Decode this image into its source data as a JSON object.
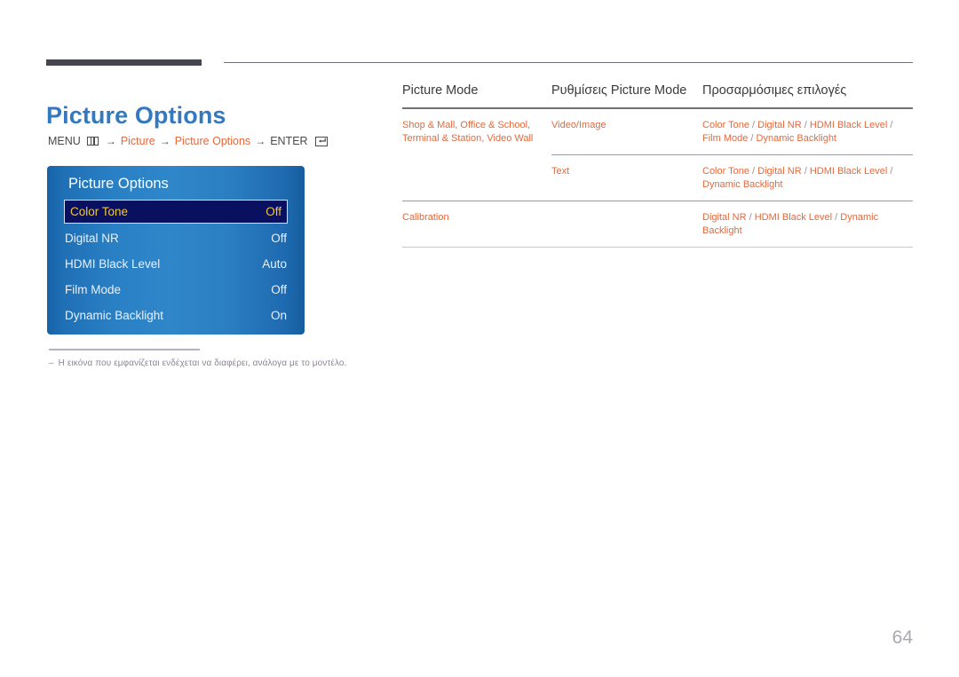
{
  "page": {
    "title": "Picture Options",
    "number": "64"
  },
  "breadcrumb": {
    "menu_label": "MENU",
    "menu_icon": "menu-grid-icon",
    "arrow": "→",
    "items": [
      "Picture",
      "Picture Options"
    ],
    "enter_label": "ENTER",
    "enter_icon": "enter-return-icon"
  },
  "osd": {
    "title": "Picture Options",
    "rows": [
      {
        "label": "Color Tone",
        "value": "Off",
        "selected": true
      },
      {
        "label": "Digital NR",
        "value": "Off",
        "selected": false
      },
      {
        "label": "HDMI Black Level",
        "value": "Auto",
        "selected": false
      },
      {
        "label": "Film Mode",
        "value": "Off",
        "selected": false
      },
      {
        "label": "Dynamic Backlight",
        "value": "On",
        "selected": false
      }
    ]
  },
  "note": {
    "dash": "–",
    "text": "Η εικόνα που εμφανίζεται ενδέχεται να διαφέρει, ανάλογα με το μοντέλο."
  },
  "table": {
    "headers": [
      "Picture Mode",
      "Ρυθμίσεις Picture Mode",
      "Προσαρμόσιμες επιλογές"
    ],
    "rows": [
      {
        "mode": "Shop & Mall, Office & School, Terminal & Station, Video Wall",
        "setting": "Video/Image",
        "options": "Color Tone / Digital NR / HDMI Black Level / Film Mode / Dynamic Backlight"
      },
      {
        "mode": "",
        "setting": "Text",
        "options": "Color Tone / Digital NR / HDMI Black Level / Dynamic Backlight"
      },
      {
        "mode": "Calibration",
        "setting": "",
        "options": "Digital NR / HDMI Black Level / Dynamic Backlight"
      }
    ]
  },
  "colors": {
    "title_blue": "#3479bd",
    "accent_orange": "#e4693c",
    "osd_highlight_bg": "#0a1060",
    "osd_highlight_text": "#f2c53d",
    "rule_dark": "#45454f",
    "page_number": "#a9a9b2"
  }
}
